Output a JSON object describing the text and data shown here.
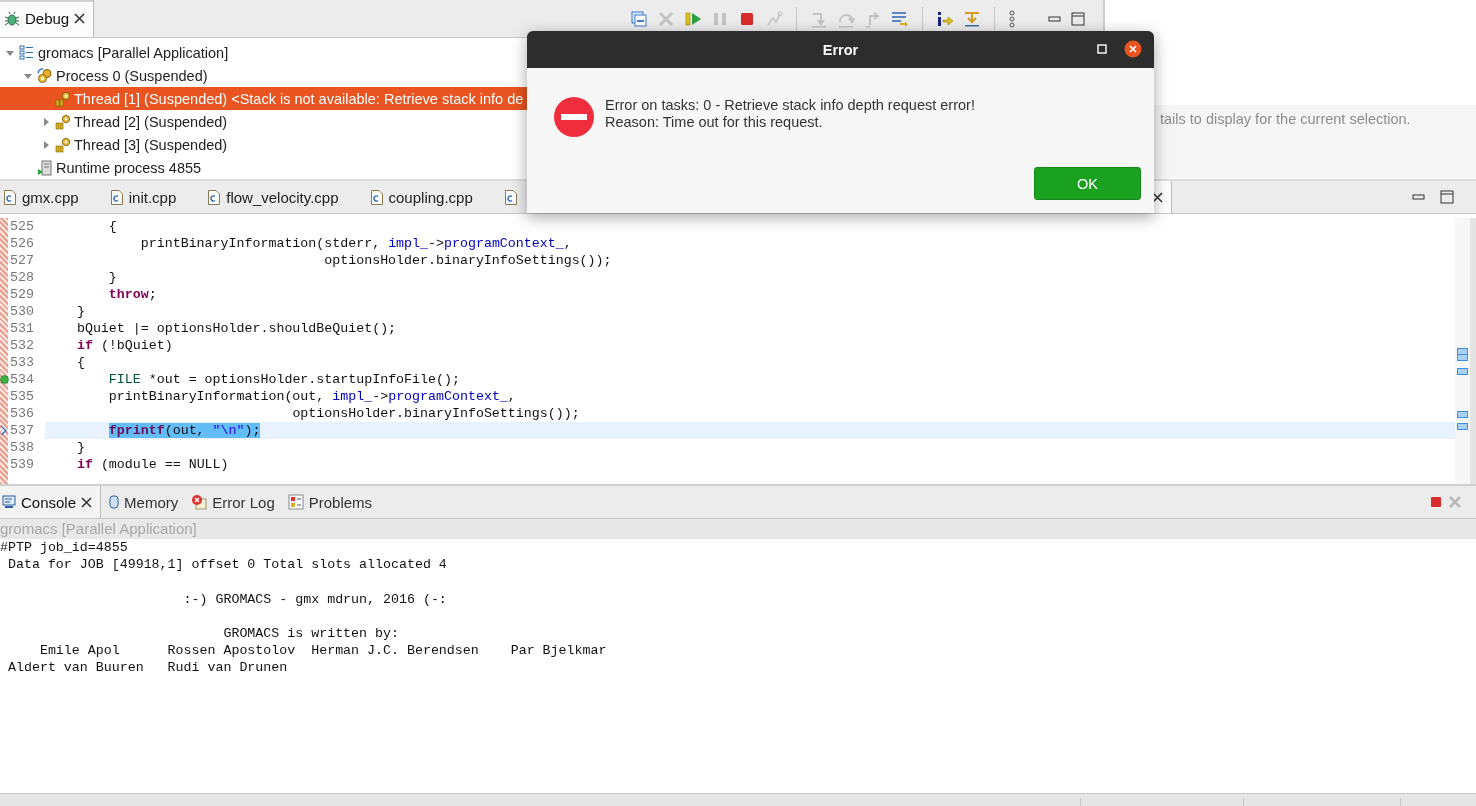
{
  "debug": {
    "tab": {
      "label": "Debug",
      "selected": true
    },
    "toolbar": [
      {
        "buttons": [
          {
            "kind": "collapse",
            "disabled": false
          },
          {
            "kind": "disconnect",
            "disabled": true
          },
          {
            "kind": "resume",
            "disabled": false
          },
          {
            "kind": "suspend",
            "disabled": true
          },
          {
            "kind": "terminate",
            "disabled": false
          },
          {
            "kind": "connect",
            "disabled": true
          }
        ]
      },
      {
        "buttons": [
          {
            "kind": "step-into",
            "disabled": true
          },
          {
            "kind": "step-over",
            "disabled": true
          },
          {
            "kind": "step-return",
            "disabled": true
          },
          {
            "kind": "instructions",
            "disabled": false
          }
        ]
      },
      {
        "buttons": [
          {
            "kind": "instruction-step",
            "disabled": false
          },
          {
            "kind": "step-filters",
            "disabled": false
          }
        ]
      }
    ],
    "tree": [
      {
        "kind": "launch",
        "label": "gromacs [Parallel Application]",
        "expanded": true,
        "selected": false,
        "children": [
          {
            "kind": "process",
            "label": "Process 0 (Suspended)",
            "expanded": true,
            "selected": false,
            "children": [
              {
                "kind": "thread",
                "label": "Thread [1] (Suspended) <Stack is not available: Retrieve stack info de",
                "selected": true
              },
              {
                "kind": "thread",
                "label": "Thread [2] (Suspended)",
                "expanded": false,
                "selected": false
              },
              {
                "kind": "thread",
                "label": "Thread [3] (Suspended)",
                "expanded": false,
                "selected": false
              }
            ]
          },
          {
            "kind": "runtime",
            "label": "Runtime process 4855",
            "selected": false
          }
        ]
      }
    ]
  },
  "details": {
    "message": "tails to display for the current selection."
  },
  "editor": {
    "tabs": [
      {
        "label": "gmx.cpp",
        "selected": false
      },
      {
        "label": "init.cpp",
        "selected": false
      },
      {
        "label": "flow_velocity.cpp",
        "selected": false
      },
      {
        "label": "coupling.cpp",
        "selected": false
      }
    ],
    "lines": [
      {
        "number": "525",
        "breakpoint": false,
        "current": false,
        "segments": [
          {
            "kind": "plain",
            "text": "        {"
          }
        ]
      },
      {
        "number": "526",
        "breakpoint": false,
        "current": false,
        "segments": [
          {
            "kind": "plain",
            "text": "            printBinaryInformation(stderr, "
          },
          {
            "kind": "field",
            "text": "impl_"
          },
          {
            "kind": "plain",
            "text": "->"
          },
          {
            "kind": "field",
            "text": "programContext_"
          },
          {
            "kind": "plain",
            "text": ","
          }
        ]
      },
      {
        "number": "527",
        "breakpoint": false,
        "current": false,
        "segments": [
          {
            "kind": "plain",
            "text": "                                   optionsHolder.binaryInfoSettings());"
          }
        ]
      },
      {
        "number": "528",
        "breakpoint": false,
        "current": false,
        "segments": [
          {
            "kind": "plain",
            "text": "        }"
          }
        ]
      },
      {
        "number": "529",
        "breakpoint": false,
        "current": false,
        "segments": [
          {
            "kind": "keyword",
            "text": "        throw"
          },
          {
            "kind": "plain",
            "text": ";"
          }
        ]
      },
      {
        "number": "530",
        "breakpoint": false,
        "current": false,
        "segments": [
          {
            "kind": "plain",
            "text": "    }"
          }
        ]
      },
      {
        "number": "531",
        "breakpoint": false,
        "current": false,
        "segments": [
          {
            "kind": "plain",
            "text": "    bQuiet |= optionsHolder.shouldBeQuiet();"
          }
        ]
      },
      {
        "number": "532",
        "breakpoint": false,
        "current": false,
        "segments": [
          {
            "kind": "keyword",
            "text": "    if"
          },
          {
            "kind": "plain",
            "text": " (!bQuiet)"
          }
        ]
      },
      {
        "number": "533",
        "breakpoint": false,
        "current": false,
        "segments": [
          {
            "kind": "plain",
            "text": "    {"
          }
        ]
      },
      {
        "number": "534",
        "breakpoint": true,
        "current": false,
        "segments": [
          {
            "kind": "type",
            "text": "        FILE"
          },
          {
            "kind": "plain",
            "text": " *out = optionsHolder.startupInfoFile();"
          }
        ]
      },
      {
        "number": "535",
        "breakpoint": false,
        "current": false,
        "segments": [
          {
            "kind": "plain",
            "text": "        printBinaryInformation(out, "
          },
          {
            "kind": "field",
            "text": "impl_"
          },
          {
            "kind": "plain",
            "text": "->"
          },
          {
            "kind": "field",
            "text": "programContext_"
          },
          {
            "kind": "plain",
            "text": ","
          }
        ]
      },
      {
        "number": "536",
        "breakpoint": false,
        "current": false,
        "segments": [
          {
            "kind": "plain",
            "text": "                               optionsHolder.binaryInfoSettings());"
          }
        ]
      },
      {
        "number": "537",
        "breakpoint": false,
        "current": true,
        "segments": [
          {
            "kind": "function",
            "text": "        fprintf"
          },
          {
            "kind": "plain",
            "text": "(out, "
          },
          {
            "kind": "string",
            "text": "\"\\n\""
          },
          {
            "kind": "plain",
            "text": ");"
          }
        ]
      },
      {
        "number": "538",
        "breakpoint": false,
        "current": false,
        "segments": [
          {
            "kind": "plain",
            "text": "    }"
          }
        ]
      },
      {
        "number": "539",
        "breakpoint": false,
        "current": false,
        "segments": [
          {
            "kind": "keyword",
            "text": "    if"
          },
          {
            "kind": "plain",
            "text": " (module == NULL)"
          }
        ]
      }
    ]
  },
  "console": {
    "tabs": [
      {
        "label": "Console",
        "kind": "console",
        "selected": true
      },
      {
        "label": "Memory",
        "kind": "memory",
        "selected": false
      },
      {
        "label": "Error Log",
        "kind": "error-log",
        "selected": false
      },
      {
        "label": "Problems",
        "kind": "problems",
        "selected": false
      }
    ],
    "subtitle": "gromacs [Parallel Application]",
    "output": "#PTP job_id=4855\n Data for JOB [49918,1] offset 0 Total slots allocated 4\n\n                       :-) GROMACS - gmx mdrun, 2016 (-:\n\n                            GROMACS is written by:\n     Emile Apol      Rossen Apostolov  Herman J.C. Berendsen    Par Bjelkmar\n Aldert van Buuren   Rudi van Drunen"
  },
  "dialog": {
    "title": "Error",
    "message": "Error on tasks: 0 - Retrieve stack info depth request error!",
    "reason": "Reason: Time out for this request.",
    "button": "OK"
  }
}
